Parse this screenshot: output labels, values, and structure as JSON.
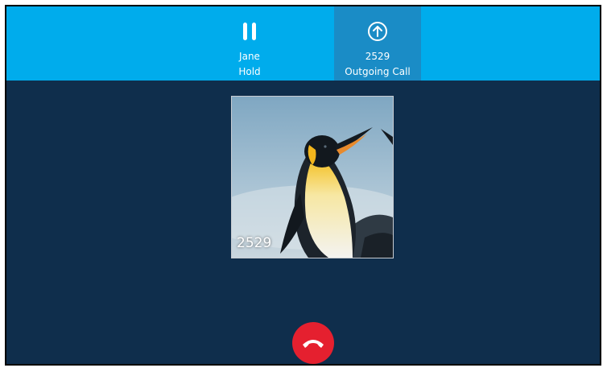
{
  "calls": [
    {
      "name": "Jane",
      "status": "Hold",
      "icon": "pause-icon",
      "active": false
    },
    {
      "name": "2529",
      "status": "Outgoing Call",
      "icon": "arrow-up-circle-icon",
      "active": true
    }
  ],
  "current_call": {
    "number": "2529",
    "avatar_image": "penguin-photo"
  },
  "end_call_button": {
    "icon": "hang-up-icon"
  },
  "colors": {
    "topbar": "#00acec",
    "active_tab": "#1a8cc6",
    "background": "#0f2e4c",
    "end_call": "#e5202f"
  }
}
